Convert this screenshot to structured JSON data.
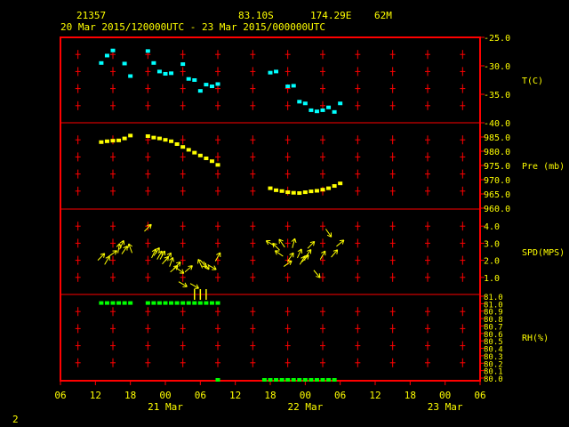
{
  "header": {
    "station": "21357",
    "lat": "83.10S",
    "lon": "174.29E",
    "elev": "62M",
    "period": "20 Mar 2015/120000UTC - 23 Mar 2015/000000UTC"
  },
  "footer_label": "2",
  "colors": {
    "frame": "#ff0000",
    "text": "#ffff00",
    "temp": "#00ffff",
    "pres": "#ffff00",
    "wind": "#ffff00",
    "rh": "#00ff00"
  },
  "chart_data": {
    "type": "scatter",
    "x_axis": {
      "range_hours": [
        -6,
        66
      ],
      "tick_labels": [
        "06",
        "12",
        "18",
        "00",
        "06",
        "12",
        "18",
        "00",
        "06",
        "12",
        "18",
        "00",
        "06"
      ],
      "day_labels": [
        {
          "label": "21 Mar",
          "at_hour": 12
        },
        {
          "label": "22 Mar",
          "at_hour": 36
        },
        {
          "label": "23 Mar",
          "at_hour": 60
        }
      ]
    },
    "panels": [
      {
        "name": "temperature",
        "label": "T(C)",
        "ylim": [
          -40,
          -25
        ],
        "ticks": [
          "-25.0",
          "-30.0",
          "-35.0",
          "-40.0"
        ],
        "tick_values": [
          -25,
          -30,
          -35,
          -40
        ],
        "x": [
          1,
          2,
          3,
          5,
          6,
          9,
          10,
          11,
          12,
          13,
          15,
          16,
          17,
          18,
          19,
          20,
          21,
          30,
          31,
          33,
          34,
          35,
          36,
          37,
          38,
          39,
          40,
          41,
          42
        ],
        "y": [
          -29.5,
          -28.2,
          -27.3,
          -29.6,
          -31.8,
          -27.4,
          -29.5,
          -31.0,
          -31.4,
          -31.3,
          -29.7,
          -32.3,
          -32.5,
          -34.4,
          -33.3,
          -33.6,
          -33.2,
          -31.2,
          -31.0,
          -33.6,
          -33.5,
          -36.3,
          -36.6,
          -37.8,
          -38.0,
          -37.8,
          -37.3,
          -38.1,
          -36.6
        ]
      },
      {
        "name": "pressure",
        "label": "Pre (mb)",
        "ylim": [
          960,
          990
        ],
        "ticks": [
          "985.0",
          "980.0",
          "975.0",
          "970.0",
          "965.0",
          "960.0"
        ],
        "tick_values": [
          985,
          980,
          975,
          970,
          965,
          960
        ],
        "x": [
          1,
          2,
          3,
          4,
          5,
          6,
          9,
          10,
          11,
          12,
          13,
          14,
          15,
          16,
          17,
          18,
          19,
          20,
          21,
          30,
          31,
          32,
          33,
          34,
          35,
          36,
          37,
          38,
          39,
          40,
          41,
          42
        ],
        "y": [
          983.2,
          983.5,
          983.7,
          983.8,
          984.5,
          985.5,
          985.3,
          984.8,
          984.5,
          984.0,
          983.5,
          982.5,
          981.5,
          980.5,
          979.5,
          978.5,
          977.5,
          976.5,
          975.2,
          967.0,
          966.3,
          966.0,
          965.6,
          965.4,
          965.3,
          965.6,
          965.9,
          966.1,
          966.5,
          967.0,
          967.8,
          968.7
        ]
      },
      {
        "name": "wind",
        "label": "SPD(MPS)",
        "ylim": [
          0,
          5
        ],
        "ticks": [
          "4.0",
          "3.0",
          "2.0",
          "1.0"
        ],
        "tick_values": [
          4,
          3,
          2,
          1
        ],
        "x": [
          1,
          2,
          3,
          4,
          4.5,
          5,
          6,
          9,
          10,
          10.5,
          11,
          11.5,
          12,
          12.5,
          13,
          13.5,
          14,
          14.5,
          15,
          16,
          17,
          18,
          18.5,
          19,
          20,
          21,
          30,
          31,
          31.5,
          32,
          33,
          33.5,
          34,
          35,
          35.5,
          36,
          36.5,
          37,
          38,
          39,
          40,
          41,
          42
        ],
        "y": [
          2.2,
          2.0,
          2.4,
          2.7,
          2.9,
          2.6,
          2.7,
          3.9,
          2.4,
          2.5,
          2.3,
          2.3,
          2.0,
          2.2,
          1.9,
          1.5,
          1.7,
          1.4,
          0.6,
          1.5,
          0.5,
          1.8,
          1.8,
          1.7,
          1.6,
          2.2,
          3.0,
          2.8,
          2.4,
          3.0,
          1.8,
          2.2,
          3.0,
          2.4,
          2.0,
          2.1,
          2.4,
          2.9,
          1.2,
          2.3,
          3.6,
          2.4,
          3.0
        ],
        "dir_deg": [
          225,
          210,
          235,
          190,
          205,
          215,
          160,
          225,
          205,
          215,
          210,
          210,
          220,
          215,
          200,
          230,
          225,
          305,
          300,
          230,
          300,
          155,
          320,
          325,
          300,
          210,
          120,
          135,
          125,
          145,
          235,
          215,
          195,
          205,
          210,
          225,
          215,
          225,
          320,
          210,
          325,
          220,
          230
        ]
      },
      {
        "name": "rh",
        "label": "RH(%)",
        "ylim": [
          80,
          81
        ],
        "ticks": [
          "81.0",
          "81.0",
          "80.9",
          "80.8",
          "80.7",
          "80.6",
          "80.5",
          "80.4",
          "80.3",
          "80.2",
          "80.1",
          "80.0"
        ],
        "tick_values": [
          81.0,
          81.0,
          80.9,
          80.8,
          80.7,
          80.6,
          80.5,
          80.4,
          80.3,
          80.2,
          80.1,
          80.0
        ],
        "x": [
          1,
          2,
          3,
          4,
          5,
          6,
          9,
          10,
          11,
          12,
          13,
          14,
          15,
          16,
          17,
          18,
          19,
          20,
          21,
          21,
          29,
          30,
          31,
          32,
          33,
          34,
          35,
          36,
          37,
          38,
          39,
          40,
          41
        ],
        "y": [
          80.9,
          80.9,
          80.9,
          80.9,
          80.9,
          80.9,
          80.9,
          80.9,
          80.9,
          80.9,
          80.9,
          80.9,
          80.9,
          80.9,
          80.9,
          80.9,
          80.9,
          80.9,
          80.9,
          80.0,
          80.0,
          80.0,
          80.0,
          80.0,
          80.0,
          80.0,
          80.0,
          80.0,
          80.0,
          80.0,
          80.0,
          80.0,
          80.0
        ]
      }
    ]
  }
}
